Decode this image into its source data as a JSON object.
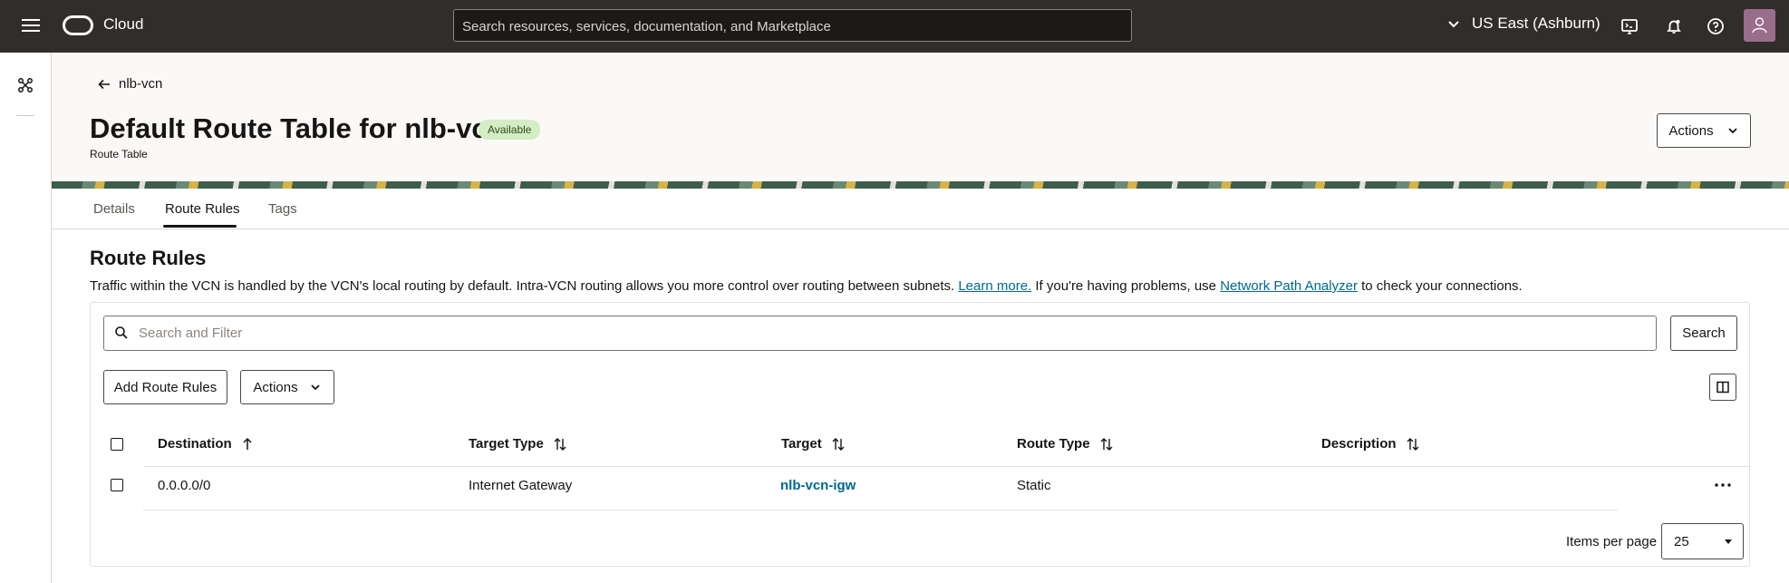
{
  "topbar": {
    "brand": "Cloud",
    "search_placeholder": "Search resources, services, documentation, and Marketplace",
    "region": "US East (Ashburn)"
  },
  "breadcrumb": {
    "back_label": "nlb-vcn"
  },
  "header": {
    "title": "Default Route Table for nlb-vcn",
    "subtitle": "Route Table",
    "status": "Available",
    "actions_label": "Actions"
  },
  "tabs": [
    {
      "label": "Details",
      "active": false
    },
    {
      "label": "Route Rules",
      "active": true
    },
    {
      "label": "Tags",
      "active": false
    }
  ],
  "section": {
    "title": "Route Rules",
    "desc_1": "Traffic within the VCN is handled by the VCN's local routing by default. Intra-VCN routing allows you more control over routing between subnets.",
    "learn_more": "Learn more.",
    "desc_2": "If you're having problems, use",
    "analyzer_link": "Network Path Analyzer",
    "desc_3": "to check your connections."
  },
  "filter": {
    "placeholder": "Search and Filter",
    "search_label": "Search"
  },
  "toolbar": {
    "add_label": "Add Route Rules",
    "actions_label": "Actions"
  },
  "table": {
    "columns": [
      "Destination",
      "Target Type",
      "Target",
      "Route Type",
      "Description"
    ],
    "rows": [
      {
        "destination": "0.0.0.0/0",
        "target_type": "Internet Gateway",
        "target": "nlb-vcn-igw",
        "route_type": "Static",
        "description": ""
      }
    ]
  },
  "pagination": {
    "label": "Items per page",
    "value": "25"
  },
  "icons": [
    "menu-icon",
    "oracle-logo-icon",
    "chevron-down-icon",
    "cloud-shell-icon",
    "bell-icon",
    "help-icon",
    "user-avatar-icon",
    "network-icon",
    "back-arrow-icon",
    "search-icon",
    "sort-asc-icon",
    "sort-icon",
    "columns-icon",
    "more-icon"
  ],
  "colors": {
    "topbar": "#312d2a",
    "link": "#00688c",
    "badge_bg": "#d4edc4"
  }
}
